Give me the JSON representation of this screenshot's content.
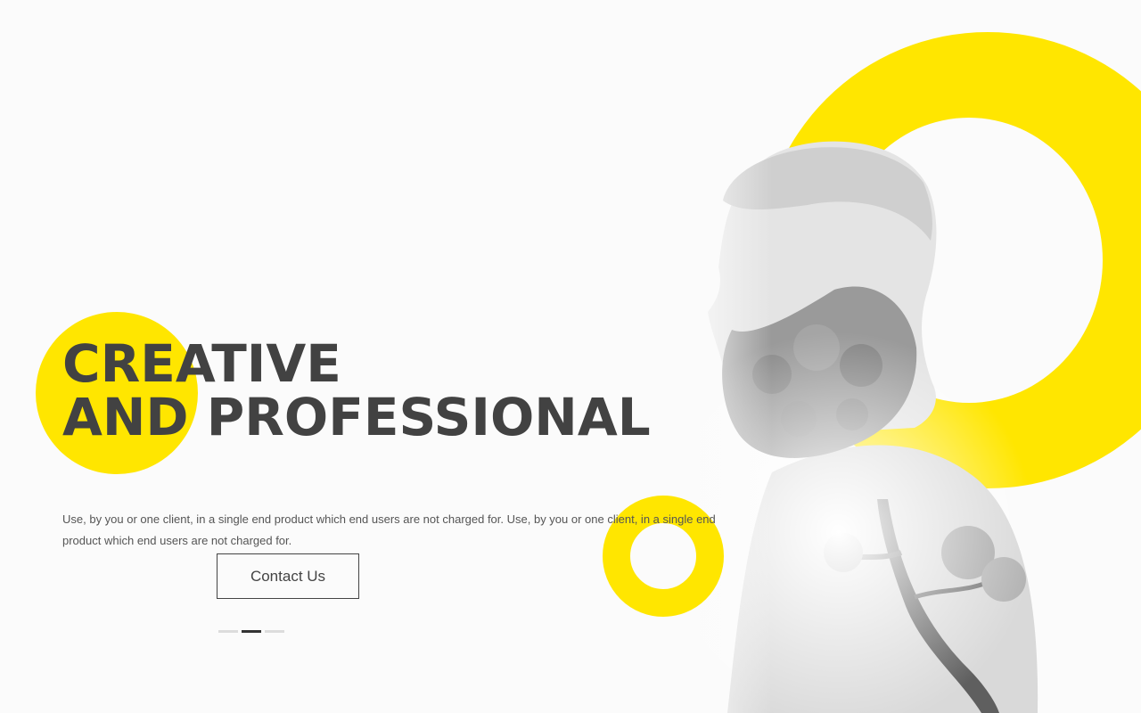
{
  "hero": {
    "title_line1": "CREATIVE",
    "title_line2": "AND PROFESSIONAL",
    "description": "Use, by you or one client, in a single end product which end users are not charged for. Use, by you or one client, in a single end product which end users are not charged for.",
    "cta_label": "Contact Us",
    "accent_color": "#ffe600",
    "text_color": "#424242"
  },
  "slider": {
    "total": 3,
    "active_index": 1
  }
}
